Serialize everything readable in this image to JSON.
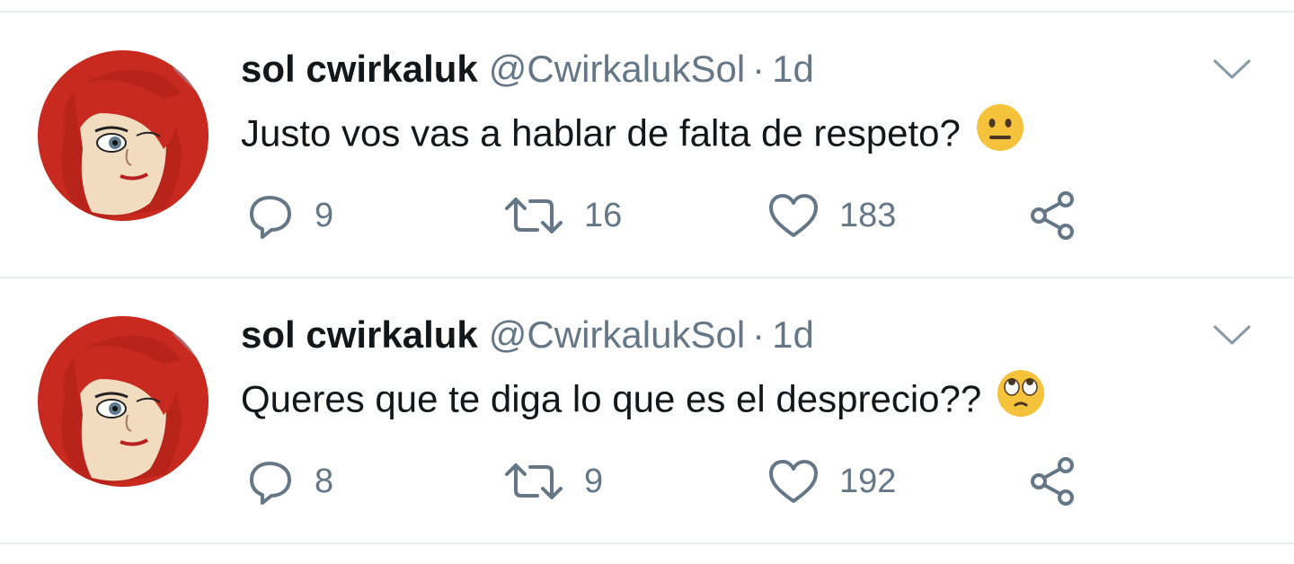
{
  "tweets": [
    {
      "author_name": "sol cwirkaluk",
      "author_handle": "@CwirkalukSol",
      "separator": "·",
      "time": "1d",
      "text": "Justo vos vas a hablar de falta de respeto?",
      "emoji": "neutral-face",
      "replies": "9",
      "retweets": "16",
      "likes": "183"
    },
    {
      "author_name": "sol cwirkaluk",
      "author_handle": "@CwirkalukSol",
      "separator": "·",
      "time": "1d",
      "text": "Queres que te diga lo que es el desprecio??",
      "emoji": "face-with-rolling-eyes",
      "replies": "8",
      "retweets": "9",
      "likes": "192"
    }
  ],
  "colors": {
    "secondary_text": "#657786",
    "primary_text": "#14171a",
    "divider": "#e6ecf0",
    "avatar_hair": "#c92a1f",
    "emoji_yellow": "#f5c33b"
  }
}
